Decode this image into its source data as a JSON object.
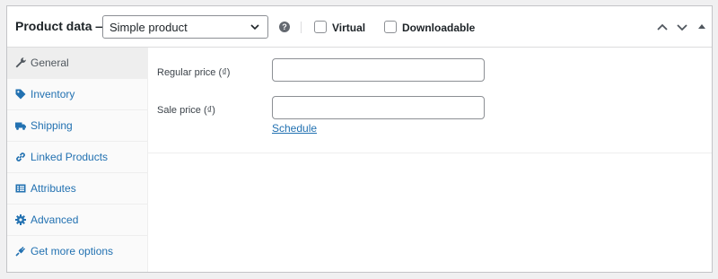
{
  "header": {
    "title": "Product data —",
    "product_type": "Simple product",
    "help_icon": "help-circle-icon",
    "virtual_label": "Virtual",
    "virtual_checked": false,
    "downloadable_label": "Downloadable",
    "downloadable_checked": false,
    "controls": [
      "move-up-icon",
      "move-down-icon",
      "toggle-panel-icon"
    ]
  },
  "sidebar": {
    "active_index": 0,
    "items": [
      {
        "label": "General",
        "icon": "wrench-icon"
      },
      {
        "label": "Inventory",
        "icon": "tag-icon"
      },
      {
        "label": "Shipping",
        "icon": "truck-icon"
      },
      {
        "label": "Linked Products",
        "icon": "link-icon"
      },
      {
        "label": "Attributes",
        "icon": "list-icon"
      },
      {
        "label": "Advanced",
        "icon": "gear-icon"
      },
      {
        "label": "Get more options",
        "icon": "plugin-icon"
      }
    ]
  },
  "general": {
    "regular_price_label": "Regular price (₫)",
    "regular_price_value": "",
    "sale_price_label": "Sale price (₫)",
    "sale_price_value": "",
    "schedule_link": "Schedule"
  },
  "colors": {
    "accent": "#2271b1",
    "text": "#1d2327",
    "border": "#c3c4c7"
  }
}
